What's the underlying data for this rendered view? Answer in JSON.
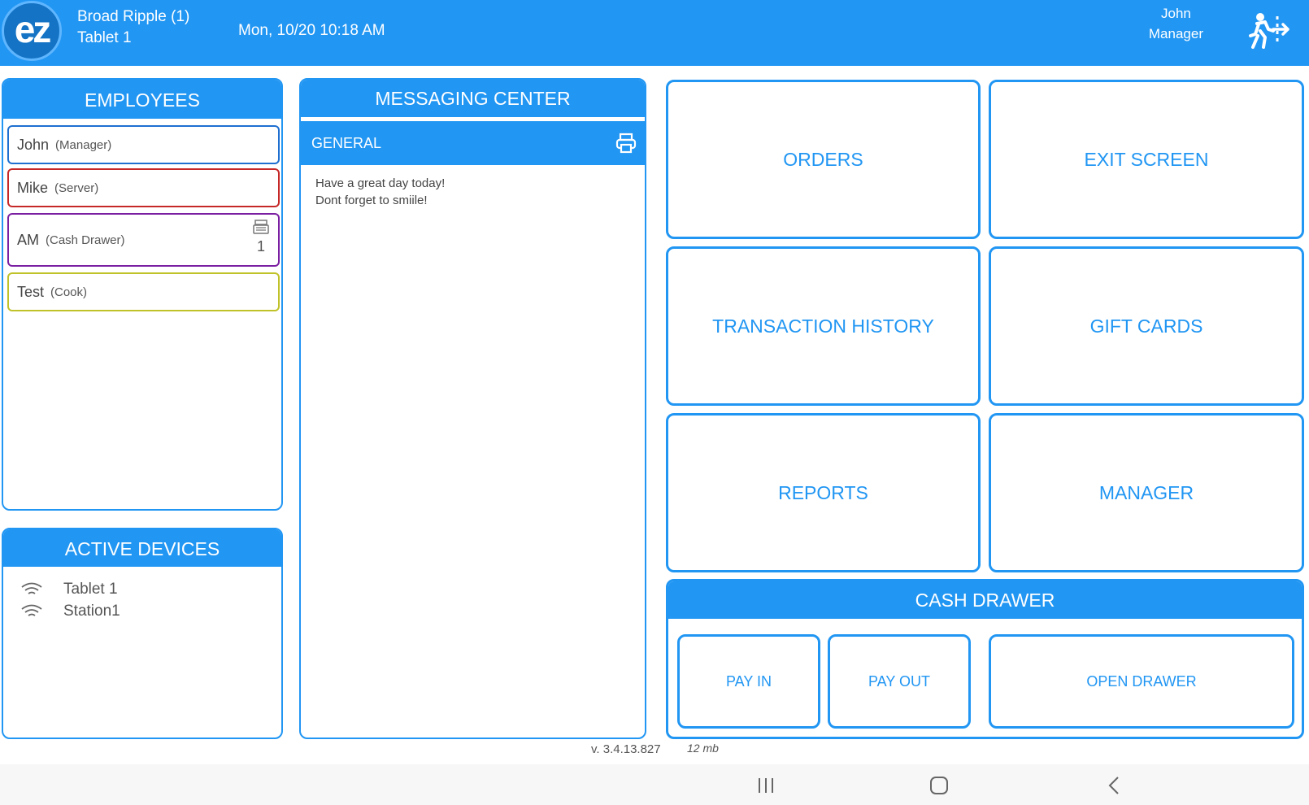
{
  "header": {
    "logo_text": "ez",
    "location": "Broad Ripple (1)",
    "device": "Tablet 1",
    "datetime": "Mon, 10/20 10:18 AM",
    "user_name": "John",
    "user_role": "Manager",
    "logout_icon": "exit-run-icon"
  },
  "employees": {
    "title": "EMPLOYEES",
    "items": [
      {
        "name": "John",
        "role": "(Manager)",
        "color": "#1e6fd0"
      },
      {
        "name": "Mike",
        "role": "(Server)",
        "color": "#c62828"
      },
      {
        "name": "AM",
        "role": "(Cash Drawer)",
        "color": "#7b1fa2",
        "drawer_count": "1",
        "icon": "cash-register-icon"
      },
      {
        "name": "Test",
        "role": "(Cook)",
        "color": "#c0c229"
      }
    ]
  },
  "active_devices": {
    "title": "ACTIVE DEVICES",
    "items": [
      {
        "name": "Tablet 1",
        "icon": "wifi-icon"
      },
      {
        "name": "Station1",
        "icon": "wifi-icon"
      }
    ]
  },
  "messaging": {
    "title": "MESSAGING CENTER",
    "channel": "GENERAL",
    "print_icon": "printer-icon",
    "lines": [
      "Have a great day today!",
      "Dont forget to smiile!"
    ]
  },
  "tiles": {
    "orders": "ORDERS",
    "exit_screen": "EXIT SCREEN",
    "transaction_history": "TRANSACTION HISTORY",
    "gift_cards": "GIFT CARDS",
    "reports": "REPORTS",
    "manager": "MANAGER"
  },
  "cash_drawer": {
    "title": "CASH DRAWER",
    "pay_in": "PAY IN",
    "pay_out": "PAY OUT",
    "open_drawer": "OPEN DRAWER"
  },
  "footer": {
    "version": "v. 3.4.13.827",
    "memory": "12  mb"
  },
  "navbar": {
    "icons": [
      "recent-apps-icon",
      "home-icon",
      "back-icon"
    ]
  },
  "colors": {
    "primary": "#2196f3"
  }
}
